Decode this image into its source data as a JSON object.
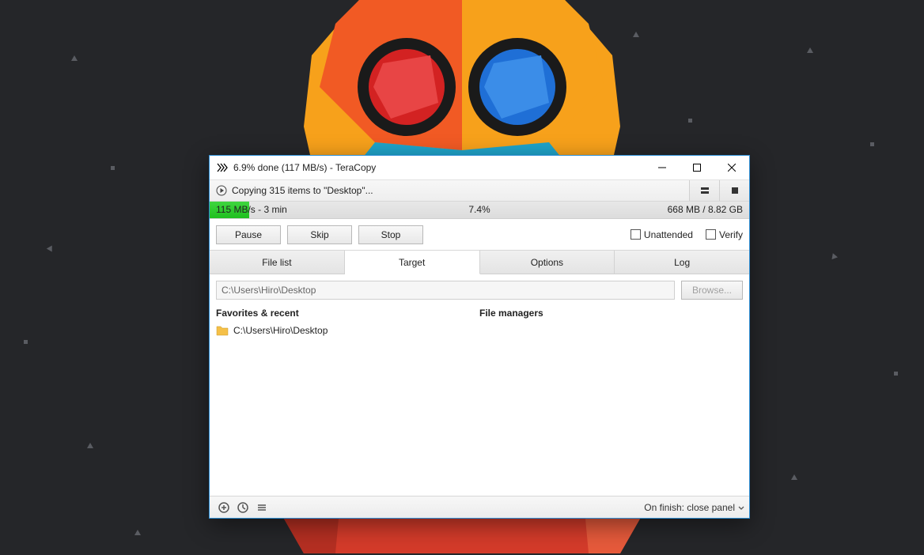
{
  "titlebar": {
    "title": "6.9% done (117 MB/s) - TeraCopy"
  },
  "status": {
    "text": "Copying 315 items to \"Desktop\"..."
  },
  "progress": {
    "speed_eta": "115 MB/s - 3 min",
    "percent": "7.4%",
    "bytes": "668 MB / 8.82 GB"
  },
  "buttons": {
    "pause": "Pause",
    "skip": "Skip",
    "stop": "Stop"
  },
  "checkboxes": {
    "unattended": "Unattended",
    "verify": "Verify"
  },
  "tabs": {
    "file_list": "File list",
    "target": "Target",
    "options": "Options",
    "log": "Log"
  },
  "target": {
    "path": "C:\\Users\\Hiro\\Desktop",
    "browse": "Browse...",
    "favorites_heading": "Favorites & recent",
    "filemanagers_heading": "File managers",
    "favorites": [
      {
        "path": "C:\\Users\\Hiro\\Desktop"
      }
    ]
  },
  "bottombar": {
    "on_finish": "On finish: close panel"
  }
}
